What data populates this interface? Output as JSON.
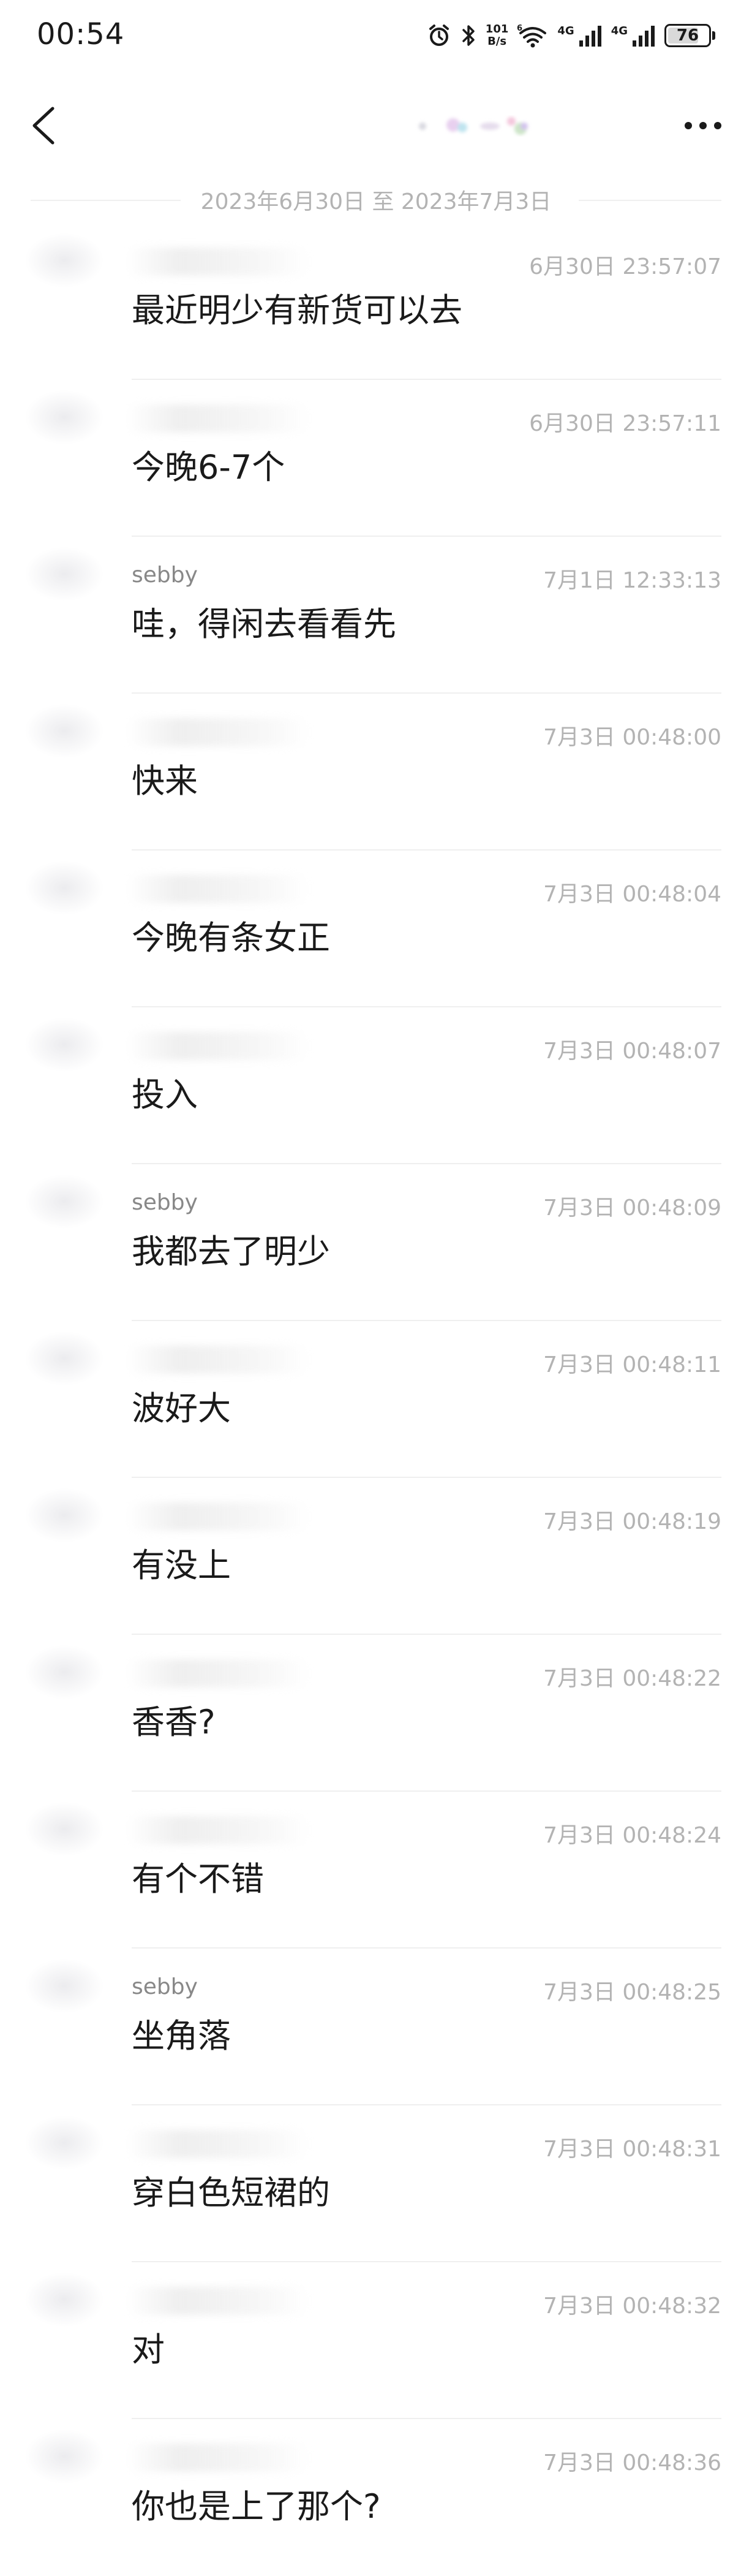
{
  "status_bar": {
    "time": "00:54",
    "net_speed_value": "101",
    "net_speed_unit": "B/s",
    "signal_label_1": "4G",
    "signal_label_2": "4G",
    "battery": "76",
    "battery_level_percent": 76
  },
  "nav": {
    "back_icon": "chevron-left-icon",
    "more_icon": "more-horizontal-icon"
  },
  "date_range": "2023年6月30日 至 2023年7月3日",
  "messages": [
    {
      "sender": "",
      "time": "6月30日 23:57:07",
      "content": "最近明少有新货可以去"
    },
    {
      "sender": "",
      "time": "6月30日 23:57:11",
      "content": "今晚6-7个"
    },
    {
      "sender": "sebby",
      "time": "7月1日 12:33:13",
      "content": "哇，得闲去看看先"
    },
    {
      "sender": "",
      "time": "7月3日 00:48:00",
      "content": "快来"
    },
    {
      "sender": "",
      "time": "7月3日 00:48:04",
      "content": "今晚有条女正"
    },
    {
      "sender": "",
      "time": "7月3日 00:48:07",
      "content": "投入"
    },
    {
      "sender": "sebby",
      "time": "7月3日 00:48:09",
      "content": "我都去了明少"
    },
    {
      "sender": "",
      "time": "7月3日 00:48:11",
      "content": "波好大"
    },
    {
      "sender": "",
      "time": "7月3日 00:48:19",
      "content": "有没上"
    },
    {
      "sender": "",
      "time": "7月3日 00:48:22",
      "content": "香香?"
    },
    {
      "sender": "",
      "time": "7月3日 00:48:24",
      "content": "有个不错"
    },
    {
      "sender": "sebby",
      "time": "7月3日 00:48:25",
      "content": "坐角落"
    },
    {
      "sender": "",
      "time": "7月3日 00:48:31",
      "content": "穿白色短裙的"
    },
    {
      "sender": "",
      "time": "7月3日 00:48:32",
      "content": "对"
    },
    {
      "sender": "",
      "time": "7月3日 00:48:36",
      "content": "你也是上了那个?"
    }
  ]
}
